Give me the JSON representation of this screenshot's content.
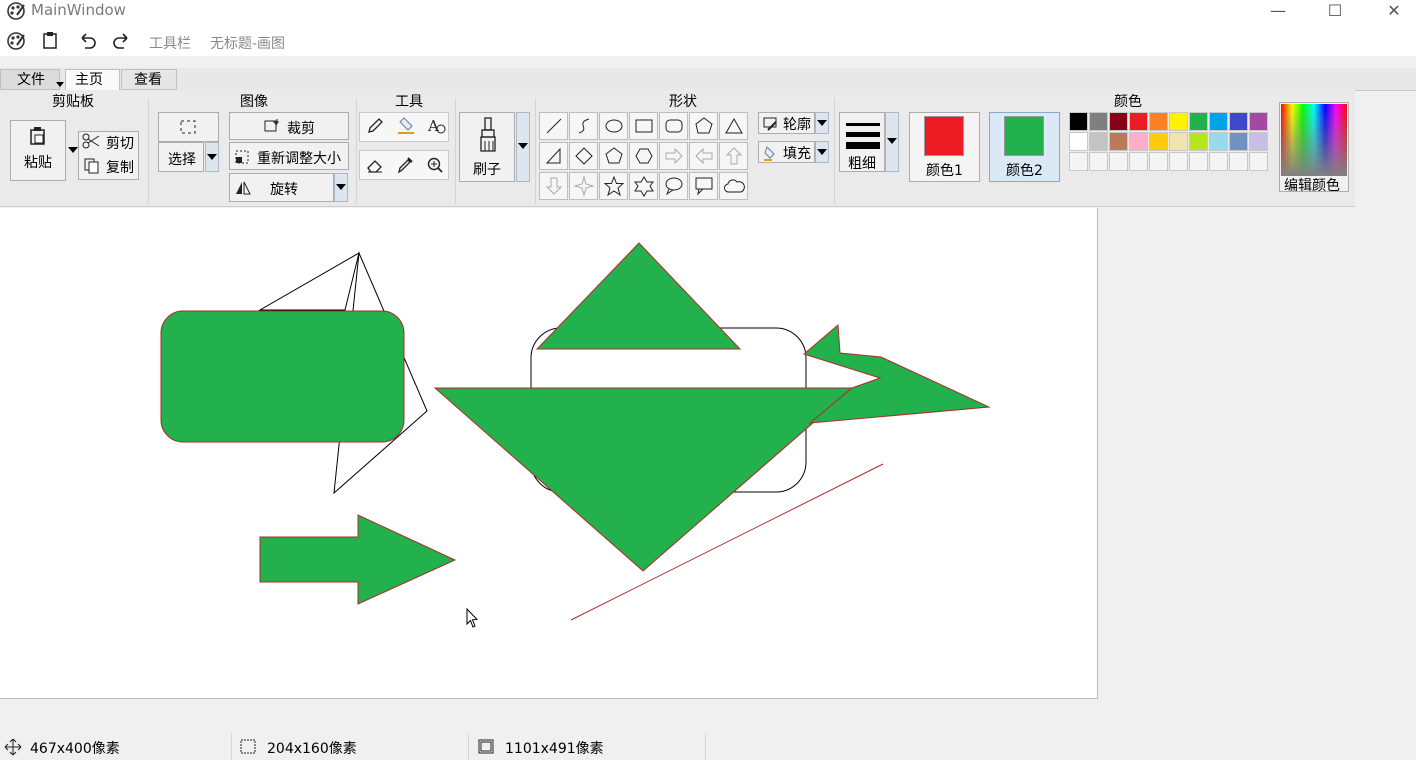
{
  "window": {
    "title": "MainWindow",
    "controls": [
      "minimize-icon",
      "maximize-icon",
      "close-icon"
    ]
  },
  "quick_toolbar": {
    "toolbar_label": "工具栏",
    "doc_title": "无标题-画图"
  },
  "tabs": [
    "文件",
    "主页",
    "查看"
  ],
  "ribbon": {
    "clipboard": {
      "title": "剪贴板",
      "paste": "粘贴",
      "cut": "剪切",
      "copy": "复制"
    },
    "image": {
      "title": "图像",
      "select": "选择",
      "crop": "裁剪",
      "resize": "重新调整大小",
      "rotate": "旋转"
    },
    "tools": {
      "title": "工具",
      "items": [
        "pencil-icon",
        "fill-icon",
        "text-icon",
        "eraser-icon",
        "color-picker-icon",
        "magnifier-icon"
      ]
    },
    "brush": {
      "label": "刷子"
    },
    "shapes": {
      "title": "形状",
      "outline": "轮廓",
      "fill": "填充",
      "items": [
        "line-icon",
        "curve-icon",
        "oval-icon",
        "rectangle-icon",
        "rounded-rectangle-icon",
        "polygon-icon",
        "triangle-icon",
        "right-triangle-icon",
        "diamond-icon",
        "pentagon-icon",
        "hexagon-icon",
        "right-arrow-icon",
        "left-arrow-icon",
        "up-arrow-icon",
        "down-arrow-icon",
        "four-point-star-icon",
        "five-point-star-icon",
        "six-point-star-icon",
        "oval-callout-icon",
        "rect-callout-icon",
        "cloud-icon"
      ]
    },
    "size": {
      "label": "粗细"
    },
    "color1": {
      "label": "颜色1",
      "color": "#ed1c24"
    },
    "color2": {
      "label": "颜色2",
      "color": "#22b14c"
    },
    "colors": {
      "title": "颜色",
      "edit": "编辑颜色",
      "palette_row1": [
        "#000000",
        "#7f7f7f",
        "#880015",
        "#ed1c24",
        "#ff7f27",
        "#fff200",
        "#22b14c",
        "#00a2e8",
        "#3f48cc",
        "#a349a4"
      ],
      "palette_row2": [
        "#ffffff",
        "#c3c3c3",
        "#b97a57",
        "#ffaec9",
        "#ffc90e",
        "#efe4b0",
        "#b5e61d",
        "#99d9ea",
        "#7092be",
        "#c8bfe7"
      ]
    }
  },
  "canvas": {
    "fill": "#22b14c",
    "stroke": "#b02a2a"
  },
  "status": {
    "cursor_pos": "467x400像素",
    "selection_size": "204x160像素",
    "canvas_size": "1101x491像素"
  }
}
